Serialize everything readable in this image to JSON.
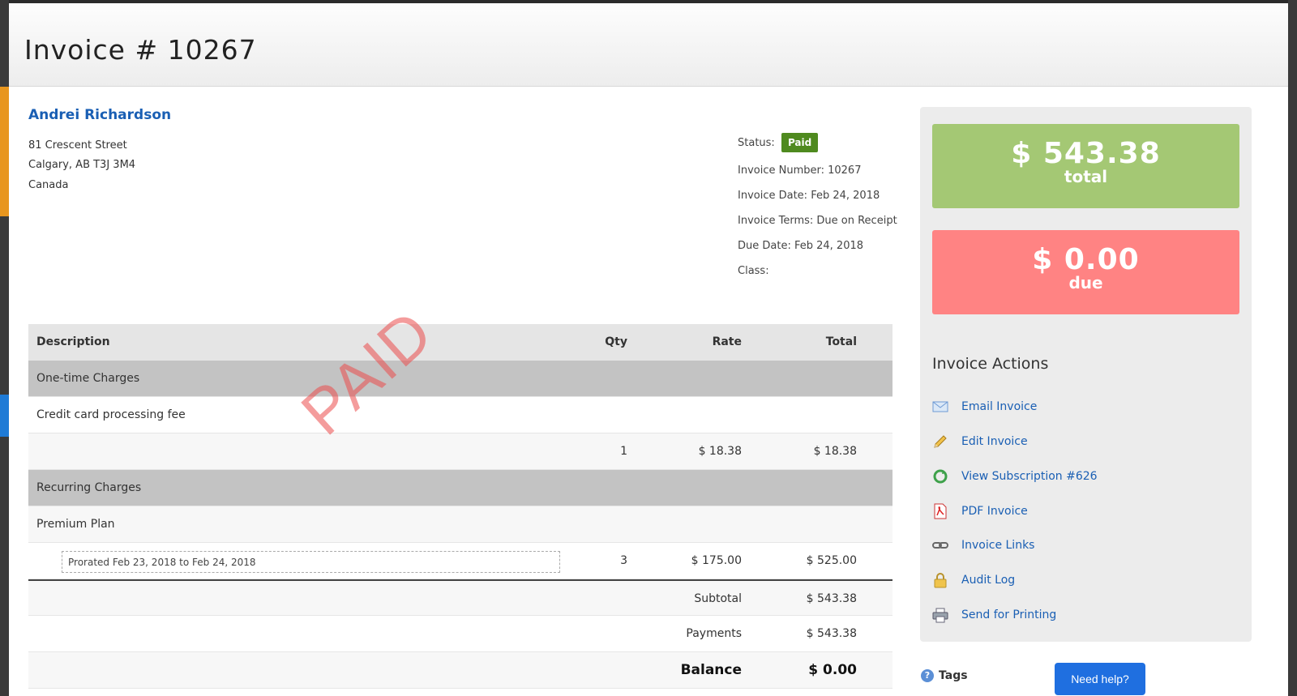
{
  "header": {
    "title": "Invoice # 10267"
  },
  "customer": {
    "name": "Andrei Richardson",
    "address": [
      "81 Crescent Street",
      "Calgary, AB T3J 3M4",
      "Canada"
    ]
  },
  "meta": {
    "status_label": "Status:",
    "status_value": "Paid",
    "invoice_number": "Invoice Number: 10267",
    "invoice_date": "Invoice Date: Feb 24, 2018",
    "invoice_terms": "Invoice Terms: Due on Receipt",
    "due_date": "Due Date: Feb 24, 2018",
    "class": "Class:"
  },
  "table": {
    "headers": {
      "description": "Description",
      "qty": "Qty",
      "rate": "Rate",
      "total": "Total"
    },
    "groups": [
      {
        "name": "One-time Charges",
        "item": "Credit card processing fee",
        "qty": "1",
        "rate": "$ 18.38",
        "total": "$ 18.38"
      },
      {
        "name": "Recurring Charges",
        "item": "Premium Plan",
        "note": "Prorated Feb 23, 2018 to Feb 24, 2018",
        "qty": "3",
        "rate": "$ 175.00",
        "total": "$ 525.00"
      }
    ],
    "subtotal_label": "Subtotal",
    "subtotal": "$ 543.38",
    "payments_label": "Payments",
    "payments": "$ 543.38",
    "balance_label": "Balance",
    "balance": "$ 0.00"
  },
  "stamp": "PAID",
  "summary": {
    "total_amount": "$ 543.38",
    "total_label": "total",
    "due_amount": "$ 0.00",
    "due_label": "due"
  },
  "actions": {
    "title": "Invoice Actions",
    "items": [
      {
        "label": "Email Invoice",
        "icon": "envelope-icon"
      },
      {
        "label": "Edit Invoice",
        "icon": "pencil-icon"
      },
      {
        "label": "View Subscription #626",
        "icon": "refresh-icon"
      },
      {
        "label": "PDF Invoice",
        "icon": "pdf-icon"
      },
      {
        "label": "Invoice Links",
        "icon": "link-icon"
      },
      {
        "label": "Audit Log",
        "icon": "lock-icon"
      },
      {
        "label": "Send for Printing",
        "icon": "printer-icon"
      }
    ]
  },
  "tags_label": "Tags",
  "help_button": "Need help?",
  "colors": {
    "link": "#1a5fb4",
    "paid_badge": "#4f8a1f",
    "total_box": "#a4c874",
    "due_box": "#ff8383",
    "stamp": "#eb4b4b"
  }
}
